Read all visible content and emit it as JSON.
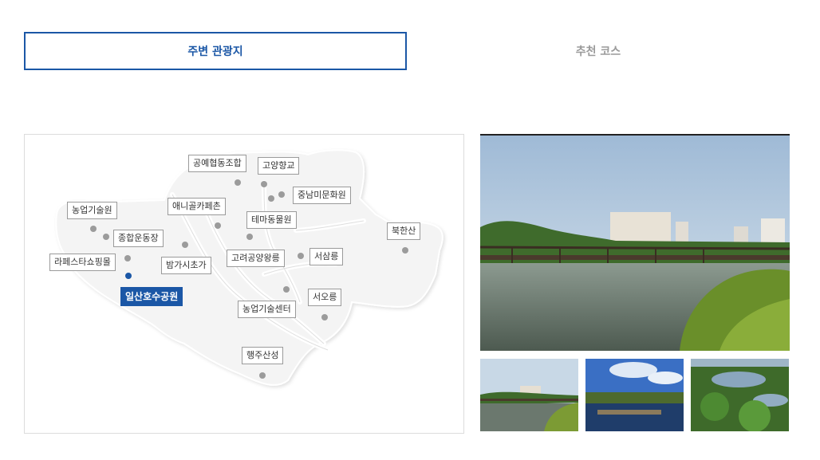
{
  "tabs": [
    {
      "label": "주변 관광지",
      "active": true
    },
    {
      "label": "추천 코스",
      "active": false
    }
  ],
  "map": {
    "places": [
      {
        "name": "공예협동조합"
      },
      {
        "name": "고양향교"
      },
      {
        "name": "중남미문화원"
      },
      {
        "name": "애니골카페촌"
      },
      {
        "name": "테마동물원"
      },
      {
        "name": "농업기술원"
      },
      {
        "name": "종합운동장"
      },
      {
        "name": "라페스타쇼핑몰"
      },
      {
        "name": "밤가시초가"
      },
      {
        "name": "고려공양왕릉"
      },
      {
        "name": "서삼릉"
      },
      {
        "name": "북한산"
      },
      {
        "name": "일산호수공원",
        "selected": true
      },
      {
        "name": "농업기술센터"
      },
      {
        "name": "서오릉"
      },
      {
        "name": "행주산성"
      }
    ]
  },
  "gallery": {
    "main_photo": "lake-bridge-photo",
    "thumbnails": [
      "lake-bridge-thumb",
      "lake-pier-thumb",
      "lake-forest-thumb"
    ]
  },
  "colors": {
    "accent": "#1b57a6",
    "inactive_tab": "#9a9a9a"
  }
}
